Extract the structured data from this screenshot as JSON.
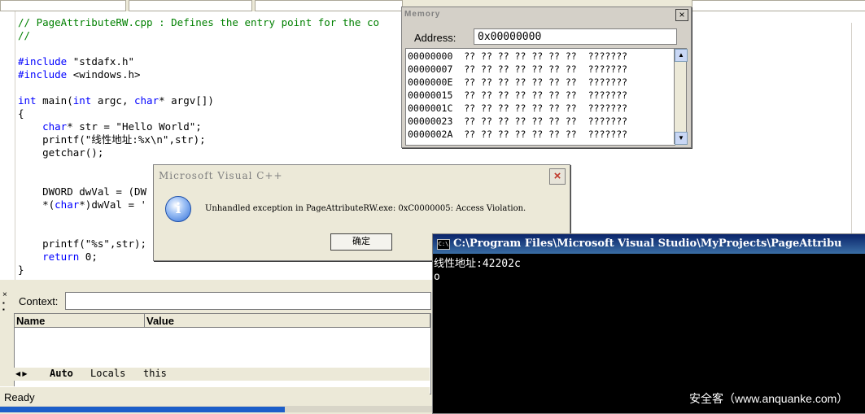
{
  "editor": {
    "lines": [
      "// PageAttributeRW.cpp : Defines the entry point for the co",
      "//",
      "",
      "#include \"stdafx.h\"",
      "#include <windows.h>",
      "",
      "int main(int argc, char* argv[])",
      "{",
      "    char* str = \"Hello World\";",
      "    printf(\"线性地址:%x\\n\",str);",
      "    getchar();",
      "",
      "",
      "    DWORD dwVal = (DW",
      "    *(char*)dwVal = '",
      "",
      "",
      "    printf(\"%s\",str);",
      "    return 0;",
      "}"
    ]
  },
  "memory": {
    "title": "Memory",
    "address_label": "Address:",
    "address_value": "0x00000000",
    "rows": [
      {
        "addr": "00000000",
        "bytes": "?? ?? ?? ?? ?? ?? ??",
        "ascii": "???????"
      },
      {
        "addr": "00000007",
        "bytes": "?? ?? ?? ?? ?? ?? ??",
        "ascii": "???????"
      },
      {
        "addr": "0000000E",
        "bytes": "?? ?? ?? ?? ?? ?? ??",
        "ascii": "???????"
      },
      {
        "addr": "00000015",
        "bytes": "?? ?? ?? ?? ?? ?? ??",
        "ascii": "???????"
      },
      {
        "addr": "0000001C",
        "bytes": "?? ?? ?? ?? ?? ?? ??",
        "ascii": "???????"
      },
      {
        "addr": "00000023",
        "bytes": "?? ?? ?? ?? ?? ?? ??",
        "ascii": "???????"
      },
      {
        "addr": "0000002A",
        "bytes": "?? ?? ?? ?? ?? ?? ??",
        "ascii": "???????"
      }
    ]
  },
  "dialog": {
    "title": "Microsoft Visual C++",
    "message": "Unhandled exception in PageAttributeRW.exe: 0xC0000005: Access Violation.",
    "ok_label": "确定",
    "icon": "info-icon"
  },
  "watch": {
    "context_label": "Context:",
    "columns": [
      "Name",
      "Value"
    ],
    "tabs": [
      "Auto",
      "Locals",
      "this"
    ]
  },
  "status": {
    "text": "Ready"
  },
  "console": {
    "title": "C:\\Program Files\\Microsoft Visual Studio\\MyProjects\\PageAttribu",
    "lines": [
      "线性地址:42202c",
      "o"
    ]
  },
  "watermark": "安全客（www.anquanke.com）"
}
